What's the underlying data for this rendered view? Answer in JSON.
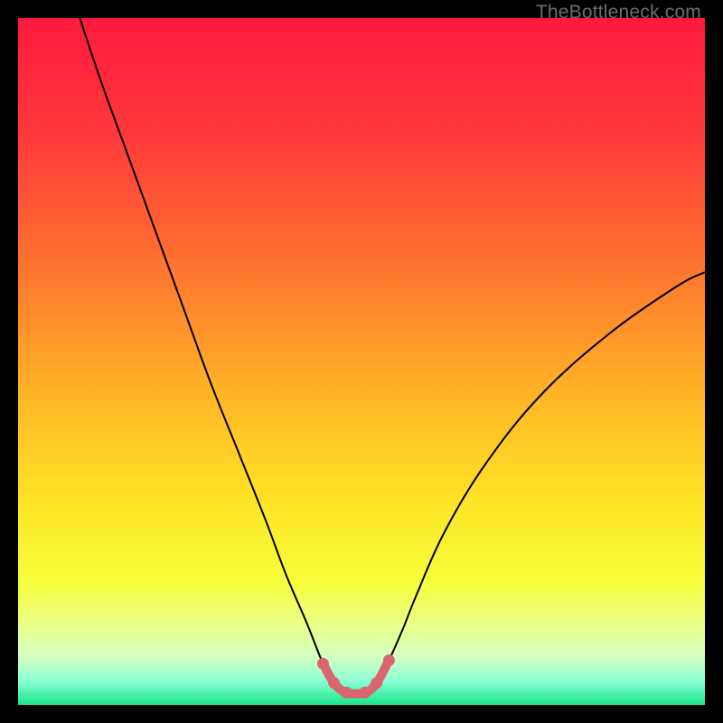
{
  "watermark": "TheBottleneck.com",
  "chart_data": {
    "type": "line",
    "title": "",
    "xlabel": "",
    "ylabel": "",
    "xlim": [
      0,
      100
    ],
    "ylim": [
      0,
      100
    ],
    "background_gradient_stops": [
      {
        "offset": 0.0,
        "color": "#ff1a3d"
      },
      {
        "offset": 0.18,
        "color": "#ff3b3b"
      },
      {
        "offset": 0.38,
        "color": "#ff7a2e"
      },
      {
        "offset": 0.55,
        "color": "#ffb526"
      },
      {
        "offset": 0.7,
        "color": "#ffe326"
      },
      {
        "offset": 0.82,
        "color": "#f6ff3a"
      },
      {
        "offset": 0.88,
        "color": "#ecff84"
      },
      {
        "offset": 0.93,
        "color": "#d5ffc3"
      },
      {
        "offset": 0.965,
        "color": "#8dffd4"
      },
      {
        "offset": 1.0,
        "color": "#18e58b"
      }
    ],
    "series": [
      {
        "name": "bottleneck-curve",
        "stroke": "#000000",
        "stroke_width": 2,
        "x": [
          9,
          12,
          16,
          20,
          24,
          28,
          32,
          36,
          39,
          42,
          44.4,
          46,
          47.8,
          50.5,
          52.2,
          54,
          56,
          58,
          62,
          68,
          76,
          86,
          96,
          100
        ],
        "y": [
          100,
          91,
          80,
          69,
          58,
          47,
          37,
          27,
          19,
          12,
          6,
          3.2,
          1.8,
          1.8,
          3.2,
          6.5,
          11,
          16,
          25,
          35,
          45,
          54,
          61,
          63
        ]
      },
      {
        "name": "valley-highlight",
        "stroke": "#d9666f",
        "stroke_width": 10,
        "linecap": "round",
        "markers": true,
        "marker_radius": 6.5,
        "marker_fill": "#d9666f",
        "x": [
          44.4,
          46.0,
          47.8,
          50.5,
          52.2,
          54.0
        ],
        "y": [
          6.0,
          3.2,
          1.8,
          1.8,
          3.2,
          6.5
        ]
      }
    ]
  }
}
